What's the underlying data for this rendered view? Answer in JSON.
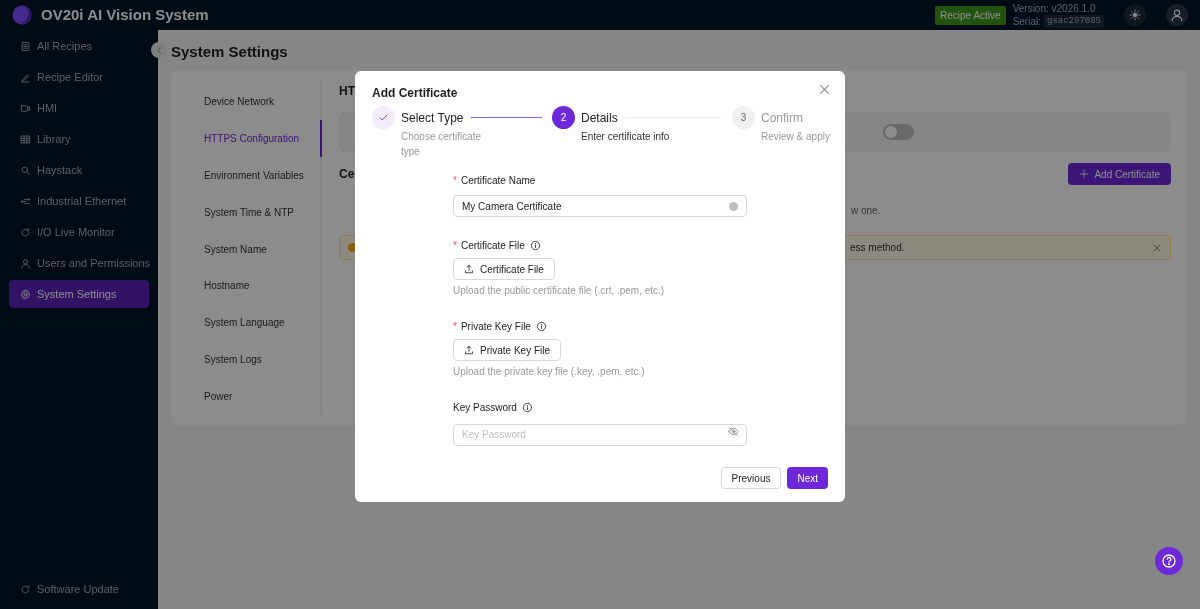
{
  "header": {
    "title": "OV20i AI Vision System",
    "badge": "Recipe Active",
    "version": "Version: v2026.1.0",
    "serial_label": "Serial:",
    "serial": "gsac297085"
  },
  "sidebar": {
    "items": [
      {
        "label": "All Recipes",
        "selected": false
      },
      {
        "label": "Recipe Editor",
        "selected": false
      },
      {
        "label": "HMI",
        "selected": false
      },
      {
        "label": "Library",
        "selected": false
      },
      {
        "label": "Haystack",
        "selected": false
      },
      {
        "label": "Industrial Ethernet",
        "selected": false
      },
      {
        "label": "I/O Live Monitor",
        "selected": false
      },
      {
        "label": "Users and Permissions",
        "selected": false
      },
      {
        "label": "System Settings",
        "selected": true
      }
    ],
    "footer": "Software Update"
  },
  "page_title": "System Settings",
  "settings_nav": [
    {
      "label": "Device Network",
      "selected": false
    },
    {
      "label": "HTTPS Configuration",
      "selected": true
    },
    {
      "label": "Environment Variables",
      "selected": false
    },
    {
      "label": "System Time & NTP",
      "selected": false
    },
    {
      "label": "System Name",
      "selected": false
    },
    {
      "label": "Hostname",
      "selected": false
    },
    {
      "label": "System Language",
      "selected": false
    },
    {
      "label": "System Logs",
      "selected": false
    },
    {
      "label": "Power",
      "selected": false
    }
  ],
  "panel": {
    "heading": "HT",
    "toggle": {
      "on": false
    },
    "section": "Ce",
    "add_button": "Add Certificate",
    "empty_text": "w one.",
    "alert": {
      "text": "ess method."
    }
  },
  "dialog": {
    "title": "Add Certificate",
    "steps": [
      {
        "done": true,
        "selected": false,
        "title": "Select Type",
        "description": "Choose certificate type"
      },
      {
        "done": false,
        "selected": true,
        "number": "2",
        "title": "Details",
        "description": "Enter certificate info"
      },
      {
        "done": false,
        "selected": false,
        "number": "3",
        "title": "Confirm",
        "description": "Review & apply"
      }
    ],
    "fields": [
      {
        "kind": "text",
        "required_mark": "*",
        "label": "Certificate Name",
        "info": false,
        "value": "My Camera Certificate"
      },
      {
        "kind": "file",
        "required_mark": "*",
        "label": "Certificate File",
        "info": true,
        "button": "Certificate File",
        "hint": "Upload the public certificate file (.crt, .pem, etc.)"
      },
      {
        "kind": "file",
        "required_mark": "*",
        "label": "Private Key File",
        "info": true,
        "button": "Private Key File",
        "hint": "Upload the private key file (.key, .pem, etc.)"
      },
      {
        "kind": "password",
        "label": "Key Password",
        "info": true,
        "placeholder": "Key Password"
      }
    ],
    "buttons": [
      {
        "label": "Previous",
        "primary": false
      },
      {
        "label": "Next",
        "primary": true
      }
    ]
  }
}
